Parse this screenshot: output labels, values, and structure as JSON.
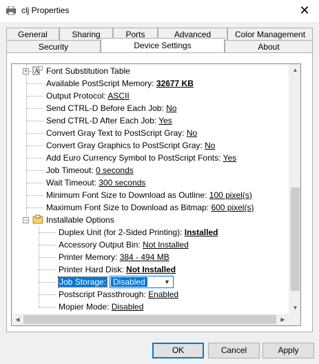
{
  "window": {
    "title": "clj Properties"
  },
  "tabs_row1": [
    {
      "label": "General"
    },
    {
      "label": "Sharing"
    },
    {
      "label": "Ports"
    },
    {
      "label": "Advanced"
    },
    {
      "label": "Color Management"
    }
  ],
  "tabs_row2": [
    {
      "label": "Security"
    },
    {
      "label": "Device Settings"
    },
    {
      "label": "About"
    }
  ],
  "tree": {
    "items": [
      {
        "label": "Font Substitution Table",
        "value": ""
      },
      {
        "label": "Available PostScript Memory: ",
        "value": "32677 KB"
      },
      {
        "label": "Output Protocol: ",
        "value": "ASCII"
      },
      {
        "label": "Send CTRL-D Before Each Job: ",
        "value": "No"
      },
      {
        "label": "Send CTRL-D After Each Job: ",
        "value": "Yes"
      },
      {
        "label": "Convert Gray Text to PostScript Gray: ",
        "value": "No"
      },
      {
        "label": "Convert Gray Graphics to PostScript Gray: ",
        "value": "No"
      },
      {
        "label": "Add Euro Currency Symbol to PostScript Fonts: ",
        "value": "Yes"
      },
      {
        "label": "Job Timeout: ",
        "value": "0 seconds"
      },
      {
        "label": "Wait Timeout: ",
        "value": "300 seconds"
      },
      {
        "label": "Minimum Font Size to Download as Outline: ",
        "value": "100 pixel(s)"
      },
      {
        "label": "Maximum Font Size to Download as Bitmap: ",
        "value": "600 pixel(s)"
      },
      {
        "label": "Installable Options",
        "value": ""
      },
      {
        "label": "Duplex Unit (for 2-Sided Printing): ",
        "value": "Installed"
      },
      {
        "label": "Accessory Output Bin: ",
        "value": "Not Installed"
      },
      {
        "label": "Printer Memory: ",
        "value": "384 - 494 MB"
      },
      {
        "label": "Printer Hard Disk: ",
        "value": "Not Installed"
      },
      {
        "label": "Job Storage:",
        "value": "Disabled"
      },
      {
        "label": "Postscript Passthrough: ",
        "value": "Enabled"
      },
      {
        "label": "Mopier Mode: ",
        "value": "Disabled"
      }
    ]
  },
  "buttons": {
    "ok": "OK",
    "cancel": "Cancel",
    "apply": "Apply"
  }
}
